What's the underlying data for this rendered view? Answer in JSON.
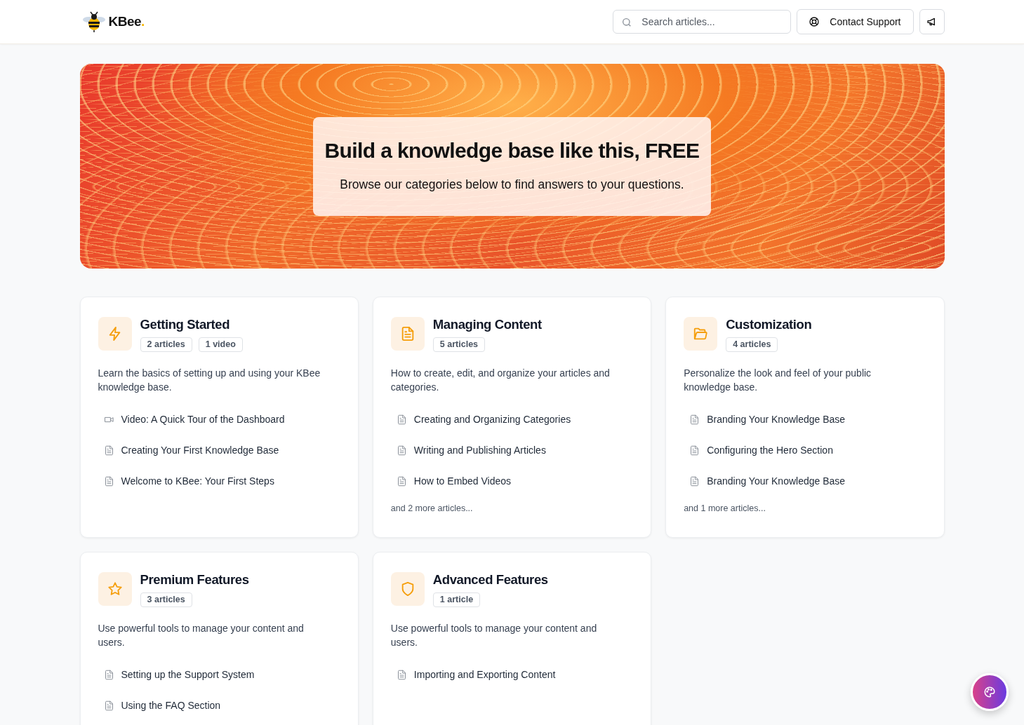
{
  "header": {
    "logo": "KBee",
    "logo_dot": ".",
    "search": {
      "placeholder": "Search articles..."
    },
    "contact_button": "Contact Support"
  },
  "hero": {
    "title": "Build a knowledge base like this, FREE",
    "subtitle": "Browse our categories below to find answers to your questions."
  },
  "categories": [
    {
      "title": "Getting Started",
      "badges": [
        "2 articles",
        "1 video"
      ],
      "description": "Learn the basics of setting up and using your KBee knowledge base.",
      "articles": [
        {
          "kind": "video",
          "title": "Video: A Quick Tour of the Dashboard"
        },
        {
          "kind": "doc",
          "title": "Creating Your First Knowledge Base"
        },
        {
          "kind": "doc",
          "title": "Welcome to KBee: Your First Steps"
        }
      ]
    },
    {
      "title": "Managing Content",
      "badges": [
        "5 articles"
      ],
      "description": "How to create, edit, and organize your articles and categories.",
      "articles": [
        {
          "kind": "doc",
          "title": "Creating and Organizing Categories"
        },
        {
          "kind": "doc",
          "title": "Writing and Publishing Articles"
        },
        {
          "kind": "doc",
          "title": "How to Embed Videos"
        }
      ],
      "more": "and 2 more articles..."
    },
    {
      "title": "Customization",
      "badges": [
        "4 articles"
      ],
      "description": "Personalize the look and feel of your public knowledge base.",
      "articles": [
        {
          "kind": "doc",
          "title": "Branding Your Knowledge Base"
        },
        {
          "kind": "doc",
          "title": "Configuring the Hero Section"
        },
        {
          "kind": "doc",
          "title": "Branding Your Knowledge Base"
        }
      ],
      "more": "and 1 more articles..."
    },
    {
      "title": "Premium Features",
      "badges": [
        "3 articles"
      ],
      "description": "Use powerful tools to manage your content and users.",
      "articles": [
        {
          "kind": "doc",
          "title": "Setting up the Support System"
        },
        {
          "kind": "doc",
          "title": "Using the FAQ Section"
        }
      ]
    },
    {
      "title": "Advanced Features",
      "badges": [
        "1 article"
      ],
      "description": "Use powerful tools to manage your content and users.",
      "articles": [
        {
          "kind": "doc",
          "title": "Importing and Exporting Content"
        }
      ]
    }
  ]
}
